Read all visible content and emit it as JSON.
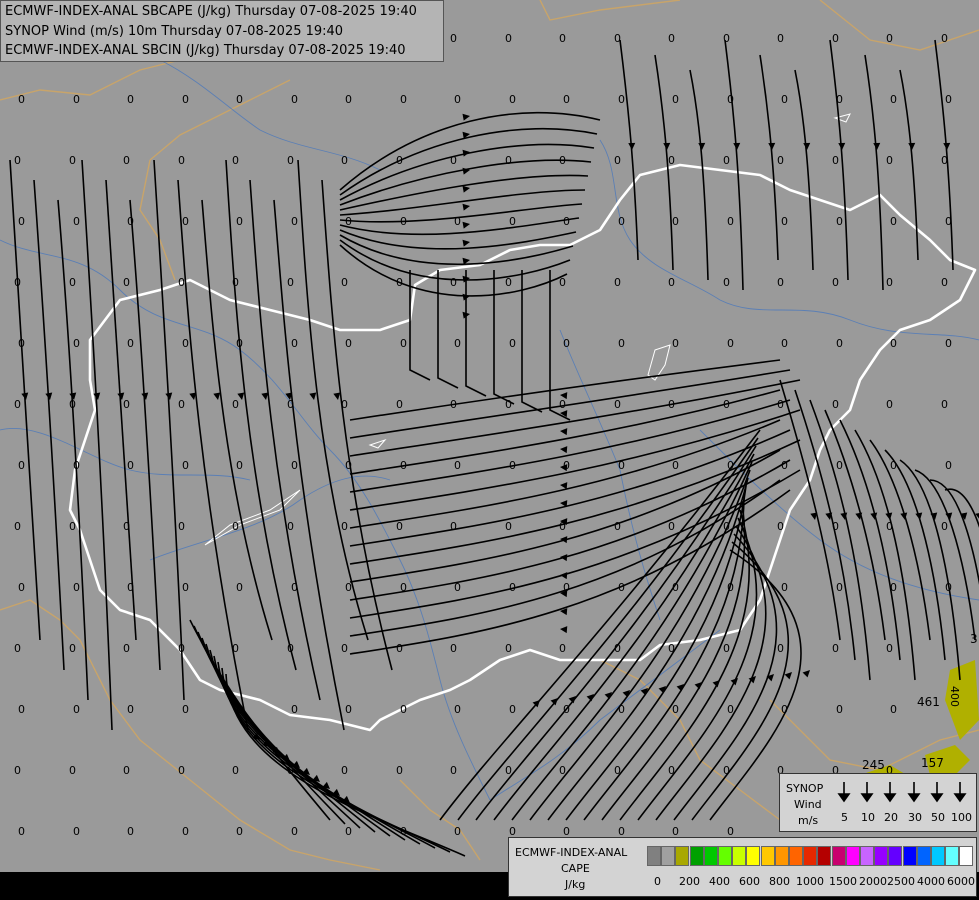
{
  "titles": {
    "line1": "ECMWF-INDEX-ANAL SBCAPE (J/kg) Thursday 07-08-2025 19:40",
    "line2": "SYNOP Wind (m/s) 10m Thursday 07-08-2025 19:40",
    "line3": "ECMWF-INDEX-ANAL SBCIN (J/kg) Thursday 07-08-2025 19:40"
  },
  "colors": {
    "background": "#9a9a9a",
    "border_white": "#ffffff",
    "rivers": "#5b7fb5",
    "country_borders": "#c8a46a",
    "cape_low": "#b0b000"
  },
  "field_labels": {
    "zero": "0",
    "v461": "461",
    "v245": "245",
    "v157": "157",
    "v3": "3",
    "v400": "400"
  },
  "wind_legend": {
    "title1": "SYNOP",
    "title2": "Wind",
    "unit": "m/s",
    "values": [
      "5",
      "10",
      "20",
      "30",
      "50",
      "100"
    ]
  },
  "cape_legend": {
    "title1": "ECMWF-INDEX-ANAL",
    "title2": "CAPE",
    "unit": "J/kg",
    "colors": [
      "#808080",
      "#a0a0a0",
      "#a8a800",
      "#00a000",
      "#00c800",
      "#64ff00",
      "#c8ff00",
      "#ffff00",
      "#ffc800",
      "#ff9600",
      "#ff6400",
      "#e62800",
      "#b40000",
      "#c8006e",
      "#ff00ff",
      "#c864ff",
      "#9600ff",
      "#6400ff",
      "#0000ff",
      "#0064ff",
      "#00c8ff",
      "#64ffff",
      "#ffffff"
    ],
    "ticks": [
      "0",
      "200",
      "400",
      "600",
      "800",
      "1000",
      "1500",
      "2000",
      "2500",
      "4000",
      "6000"
    ]
  }
}
